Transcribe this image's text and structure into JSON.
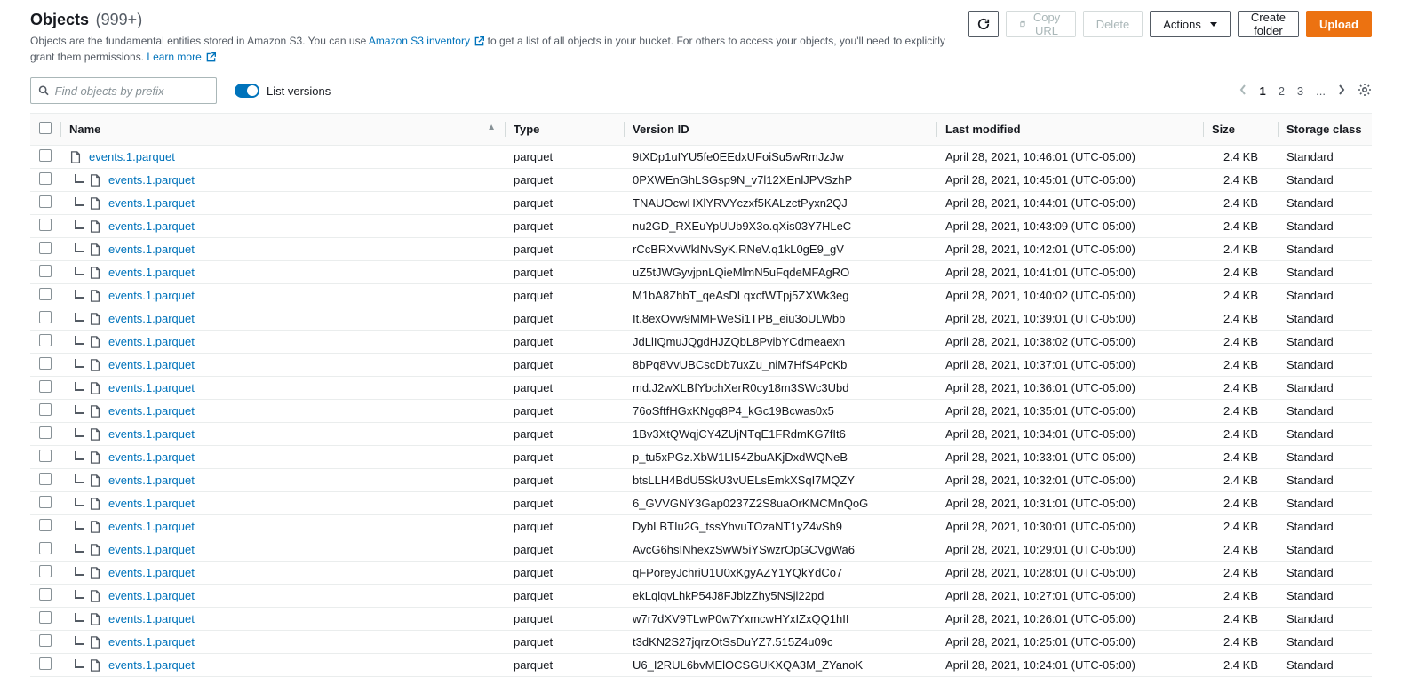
{
  "header": {
    "title": "Objects",
    "count": "(999+)",
    "subtitle_prefix": "Objects are the fundamental entities stored in Amazon S3. You can use ",
    "subtitle_link1": "Amazon S3 inventory",
    "subtitle_mid": " to get a list of all objects in your bucket. For others to access your objects, you'll need to explicitly grant them permissions. ",
    "subtitle_link2": "Learn more"
  },
  "actions": {
    "copy_url": "Copy URL",
    "delete": "Delete",
    "actions_menu": "Actions",
    "create_folder": "Create folder",
    "upload": "Upload"
  },
  "search": {
    "placeholder": "Find objects by prefix"
  },
  "toggle_label": "List versions",
  "pagination": {
    "p1": "1",
    "p2": "2",
    "p3": "3",
    "more": "..."
  },
  "columns": {
    "name": "Name",
    "type": "Type",
    "version_id": "Version ID",
    "last_modified": "Last modified",
    "size": "Size",
    "storage_class": "Storage class"
  },
  "rows": [
    {
      "indent": false,
      "link": false,
      "name": "events.1.parquet",
      "type": "parquet",
      "version_id": "9tXDp1uIYU5fe0EEdxUFoiSu5wRmJzJw",
      "last_modified": "April 28, 2021, 10:46:01 (UTC-05:00)",
      "size": "2.4 KB",
      "storage_class": "Standard"
    },
    {
      "indent": true,
      "link": true,
      "name": "events.1.parquet",
      "type": "parquet",
      "version_id": "0PXWEnGhLSGsp9N_v7l12XEnlJPVSzhP",
      "last_modified": "April 28, 2021, 10:45:01 (UTC-05:00)",
      "size": "2.4 KB",
      "storage_class": "Standard"
    },
    {
      "indent": true,
      "link": true,
      "name": "events.1.parquet",
      "type": "parquet",
      "version_id": "TNAUOcwHXlYRVYczxf5KALzctPyxn2QJ",
      "last_modified": "April 28, 2021, 10:44:01 (UTC-05:00)",
      "size": "2.4 KB",
      "storage_class": "Standard"
    },
    {
      "indent": true,
      "link": true,
      "name": "events.1.parquet",
      "type": "parquet",
      "version_id": "nu2GD_RXEuYpUUb9X3o.qXis03Y7HLeC",
      "last_modified": "April 28, 2021, 10:43:09 (UTC-05:00)",
      "size": "2.4 KB",
      "storage_class": "Standard"
    },
    {
      "indent": true,
      "link": true,
      "name": "events.1.parquet",
      "type": "parquet",
      "version_id": "rCcBRXvWkINvSyK.RNeV.q1kL0gE9_gV",
      "last_modified": "April 28, 2021, 10:42:01 (UTC-05:00)",
      "size": "2.4 KB",
      "storage_class": "Standard"
    },
    {
      "indent": true,
      "link": true,
      "name": "events.1.parquet",
      "type": "parquet",
      "version_id": "uZ5tJWGyvjpnLQieMlmN5uFqdeMFAgRO",
      "last_modified": "April 28, 2021, 10:41:01 (UTC-05:00)",
      "size": "2.4 KB",
      "storage_class": "Standard"
    },
    {
      "indent": true,
      "link": true,
      "name": "events.1.parquet",
      "type": "parquet",
      "version_id": "M1bA8ZhbT_qeAsDLqxcfWTpj5ZXWk3eg",
      "last_modified": "April 28, 2021, 10:40:02 (UTC-05:00)",
      "size": "2.4 KB",
      "storage_class": "Standard"
    },
    {
      "indent": true,
      "link": true,
      "name": "events.1.parquet",
      "type": "parquet",
      "version_id": "It.8exOvw9MMFWeSi1TPB_eiu3oULWbb",
      "last_modified": "April 28, 2021, 10:39:01 (UTC-05:00)",
      "size": "2.4 KB",
      "storage_class": "Standard"
    },
    {
      "indent": true,
      "link": true,
      "name": "events.1.parquet",
      "type": "parquet",
      "version_id": "JdLlIQmuJQgdHJZQbL8PvibYCdmeaexn",
      "last_modified": "April 28, 2021, 10:38:02 (UTC-05:00)",
      "size": "2.4 KB",
      "storage_class": "Standard"
    },
    {
      "indent": true,
      "link": true,
      "name": "events.1.parquet",
      "type": "parquet",
      "version_id": "8bPq8VvUBCscDb7uxZu_niM7HfS4PcKb",
      "last_modified": "April 28, 2021, 10:37:01 (UTC-05:00)",
      "size": "2.4 KB",
      "storage_class": "Standard"
    },
    {
      "indent": true,
      "link": true,
      "name": "events.1.parquet",
      "type": "parquet",
      "version_id": "md.J2wXLBfYbchXerR0cy18m3SWc3Ubd",
      "last_modified": "April 28, 2021, 10:36:01 (UTC-05:00)",
      "size": "2.4 KB",
      "storage_class": "Standard"
    },
    {
      "indent": true,
      "link": true,
      "name": "events.1.parquet",
      "type": "parquet",
      "version_id": "76oSftfHGxKNgq8P4_kGc19Bcwas0x5",
      "last_modified": "April 28, 2021, 10:35:01 (UTC-05:00)",
      "size": "2.4 KB",
      "storage_class": "Standard"
    },
    {
      "indent": true,
      "link": true,
      "name": "events.1.parquet",
      "type": "parquet",
      "version_id": "1Bv3XtQWqjCY4ZUjNTqE1FRdmKG7fIt6",
      "last_modified": "April 28, 2021, 10:34:01 (UTC-05:00)",
      "size": "2.4 KB",
      "storage_class": "Standard"
    },
    {
      "indent": true,
      "link": true,
      "name": "events.1.parquet",
      "type": "parquet",
      "version_id": "p_tu5xPGz.XbW1LI54ZbuAKjDxdWQNeB",
      "last_modified": "April 28, 2021, 10:33:01 (UTC-05:00)",
      "size": "2.4 KB",
      "storage_class": "Standard"
    },
    {
      "indent": true,
      "link": true,
      "name": "events.1.parquet",
      "type": "parquet",
      "version_id": "btsLLH4BdU5SkU3vUELsEmkXSqI7MQZY",
      "last_modified": "April 28, 2021, 10:32:01 (UTC-05:00)",
      "size": "2.4 KB",
      "storage_class": "Standard"
    },
    {
      "indent": true,
      "link": true,
      "name": "events.1.parquet",
      "type": "parquet",
      "version_id": "6_GVVGNY3Gap0237Z2S8uaOrKMCMnQoG",
      "last_modified": "April 28, 2021, 10:31:01 (UTC-05:00)",
      "size": "2.4 KB",
      "storage_class": "Standard"
    },
    {
      "indent": true,
      "link": true,
      "name": "events.1.parquet",
      "type": "parquet",
      "version_id": "DybLBTIu2G_tssYhvuTOzaNT1yZ4vSh9",
      "last_modified": "April 28, 2021, 10:30:01 (UTC-05:00)",
      "size": "2.4 KB",
      "storage_class": "Standard"
    },
    {
      "indent": true,
      "link": true,
      "name": "events.1.parquet",
      "type": "parquet",
      "version_id": "AvcG6hsINhexzSwW5iYSwzrOpGCVgWa6",
      "last_modified": "April 28, 2021, 10:29:01 (UTC-05:00)",
      "size": "2.4 KB",
      "storage_class": "Standard"
    },
    {
      "indent": true,
      "link": true,
      "name": "events.1.parquet",
      "type": "parquet",
      "version_id": "qFPoreyJchriU1U0xKgyAZY1YQkYdCo7",
      "last_modified": "April 28, 2021, 10:28:01 (UTC-05:00)",
      "size": "2.4 KB",
      "storage_class": "Standard"
    },
    {
      "indent": true,
      "link": true,
      "name": "events.1.parquet",
      "type": "parquet",
      "version_id": "ekLqlqvLhkP54J8FJblzZhy5NSjl22pd",
      "last_modified": "April 28, 2021, 10:27:01 (UTC-05:00)",
      "size": "2.4 KB",
      "storage_class": "Standard"
    },
    {
      "indent": true,
      "link": true,
      "name": "events.1.parquet",
      "type": "parquet",
      "version_id": "w7r7dXV9TLwP0w7YxmcwHYxIZxQQ1hII",
      "last_modified": "April 28, 2021, 10:26:01 (UTC-05:00)",
      "size": "2.4 KB",
      "storage_class": "Standard"
    },
    {
      "indent": true,
      "link": true,
      "name": "events.1.parquet",
      "type": "parquet",
      "version_id": "t3dKN2S27jqrzOtSsDuYZ7.515Z4u09c",
      "last_modified": "April 28, 2021, 10:25:01 (UTC-05:00)",
      "size": "2.4 KB",
      "storage_class": "Standard"
    },
    {
      "indent": true,
      "link": true,
      "name": "events.1.parquet",
      "type": "parquet",
      "version_id": "U6_I2RUL6bvMElOCSGUKXQA3M_ZYanoK",
      "last_modified": "April 28, 2021, 10:24:01 (UTC-05:00)",
      "size": "2.4 KB",
      "storage_class": "Standard"
    }
  ]
}
